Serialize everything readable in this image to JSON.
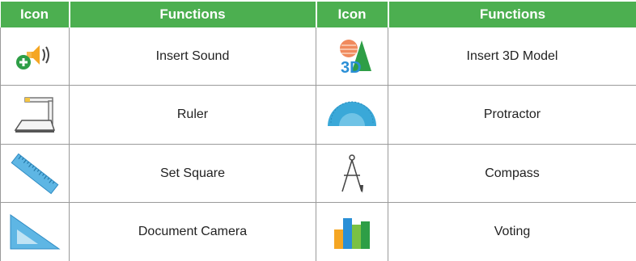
{
  "header": {
    "icon_col_1": "Icon",
    "functions_col_1": "Functions",
    "icon_col_2": "Icon",
    "functions_col_2": "Functions"
  },
  "rows": [
    {
      "left": {
        "icon": "insert-sound-icon",
        "label": "Insert Sound"
      },
      "right": {
        "icon": "insert-3d-model-icon",
        "label": "Insert 3D Model",
        "icon_text": "3D"
      }
    },
    {
      "left": {
        "icon": "document-camera-icon",
        "label": "Ruler"
      },
      "right": {
        "icon": "protractor-icon",
        "label": "Protractor"
      }
    },
    {
      "left": {
        "icon": "ruler-icon",
        "label": "Set Square"
      },
      "right": {
        "icon": "compass-icon",
        "label": "Compass"
      }
    },
    {
      "left": {
        "icon": "set-square-icon",
        "label": "Document Camera"
      },
      "right": {
        "icon": "voting-icon",
        "label": "Voting"
      }
    }
  ],
  "colors": {
    "header_bg": "#4caf50",
    "header_text": "#ffffff",
    "grid_line": "#9a9a9a"
  }
}
